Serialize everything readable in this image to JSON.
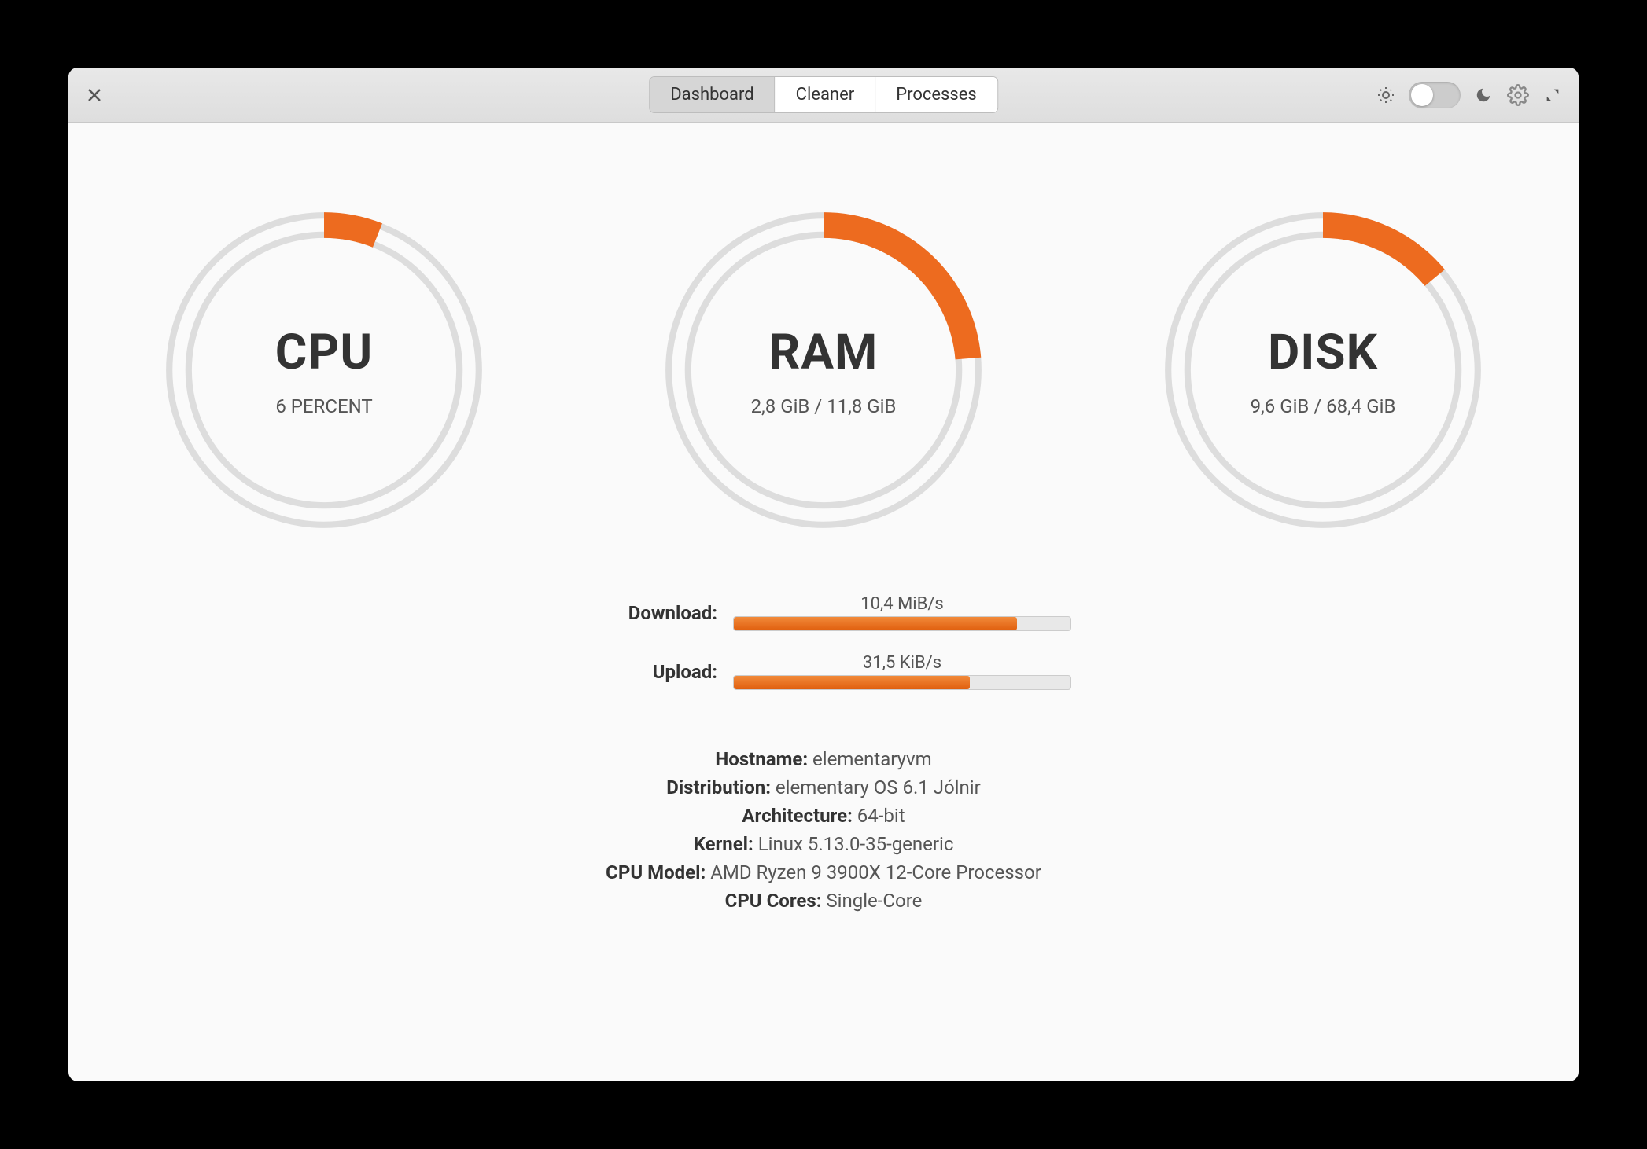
{
  "tabs": {
    "dashboard": "Dashboard",
    "cleaner": "Cleaner",
    "processes": "Processes",
    "active": "dashboard"
  },
  "gauges": {
    "cpu": {
      "title": "CPU",
      "sub": "6 PERCENT",
      "percent": 6
    },
    "ram": {
      "title": "RAM",
      "sub": "2,8 GiB / 11,8 GiB",
      "percent": 23.7
    },
    "disk": {
      "title": "DISK",
      "sub": "9,6 GiB / 68,4 GiB",
      "percent": 14.0
    }
  },
  "network": {
    "download_label": "Download:",
    "upload_label": "Upload:",
    "download_value": "10,4 MiB/s",
    "upload_value": "31,5 KiB/s",
    "download_percent": 84,
    "upload_percent": 70
  },
  "sysinfo": {
    "hostname_label": "Hostname:",
    "hostname_value": "elementaryvm",
    "distribution_label": "Distribution:",
    "distribution_value": "elementary OS 6.1 Jólnir",
    "architecture_label": "Architecture:",
    "architecture_value": "64-bit",
    "kernel_label": "Kernel:",
    "kernel_value": "Linux 5.13.0-35-generic",
    "cpu_model_label": "CPU Model:",
    "cpu_model_value": "AMD Ryzen 9 3900X 12-Core Processor",
    "cpu_cores_label": "CPU Cores:",
    "cpu_cores_value": "Single-Core"
  },
  "colors": {
    "accent": "#ed6b1f"
  }
}
